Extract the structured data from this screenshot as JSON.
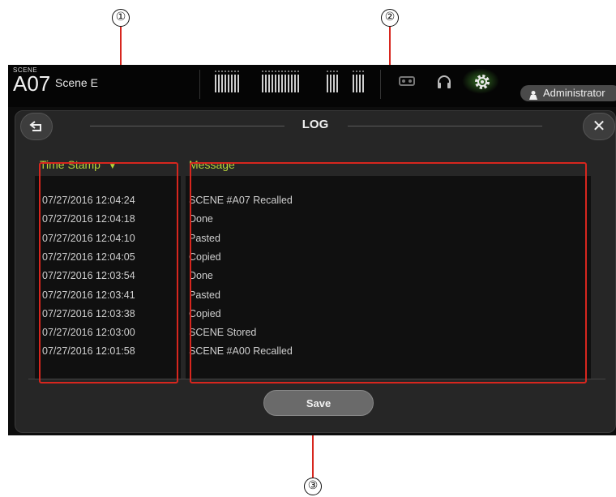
{
  "callouts": [
    "①",
    "②",
    "③"
  ],
  "header": {
    "scene_caption": "SCENE",
    "scene_number": "A07",
    "scene_name": "Scene E",
    "user_label": "Administrator"
  },
  "dialog": {
    "title": "LOG",
    "back_icon": "back-arrow-icon",
    "close_icon": "close-icon",
    "close_glyph": "✕",
    "columns": {
      "timestamp_label": "Time Stamp",
      "sort_indicator": "▼",
      "message_label": "Message"
    },
    "rows": [
      {
        "time": "07/27/2016 12:04:24",
        "message": "SCENE #A07 Recalled"
      },
      {
        "time": "07/27/2016 12:04:18",
        "message": "Done"
      },
      {
        "time": "07/27/2016 12:04:10",
        "message": "Pasted"
      },
      {
        "time": "07/27/2016 12:04:05",
        "message": "Copied"
      },
      {
        "time": "07/27/2016 12:03:54",
        "message": "Done"
      },
      {
        "time": "07/27/2016 12:03:41",
        "message": "Pasted"
      },
      {
        "time": "07/27/2016 12:03:38",
        "message": "Copied"
      },
      {
        "time": "07/27/2016 12:03:00",
        "message": "SCENE Stored"
      },
      {
        "time": "07/27/2016 12:01:58",
        "message": "SCENE #A00 Recalled"
      }
    ],
    "save_label": "Save"
  },
  "colors": {
    "accent_green": "#b7d33a",
    "callout_red": "#d7261e"
  }
}
